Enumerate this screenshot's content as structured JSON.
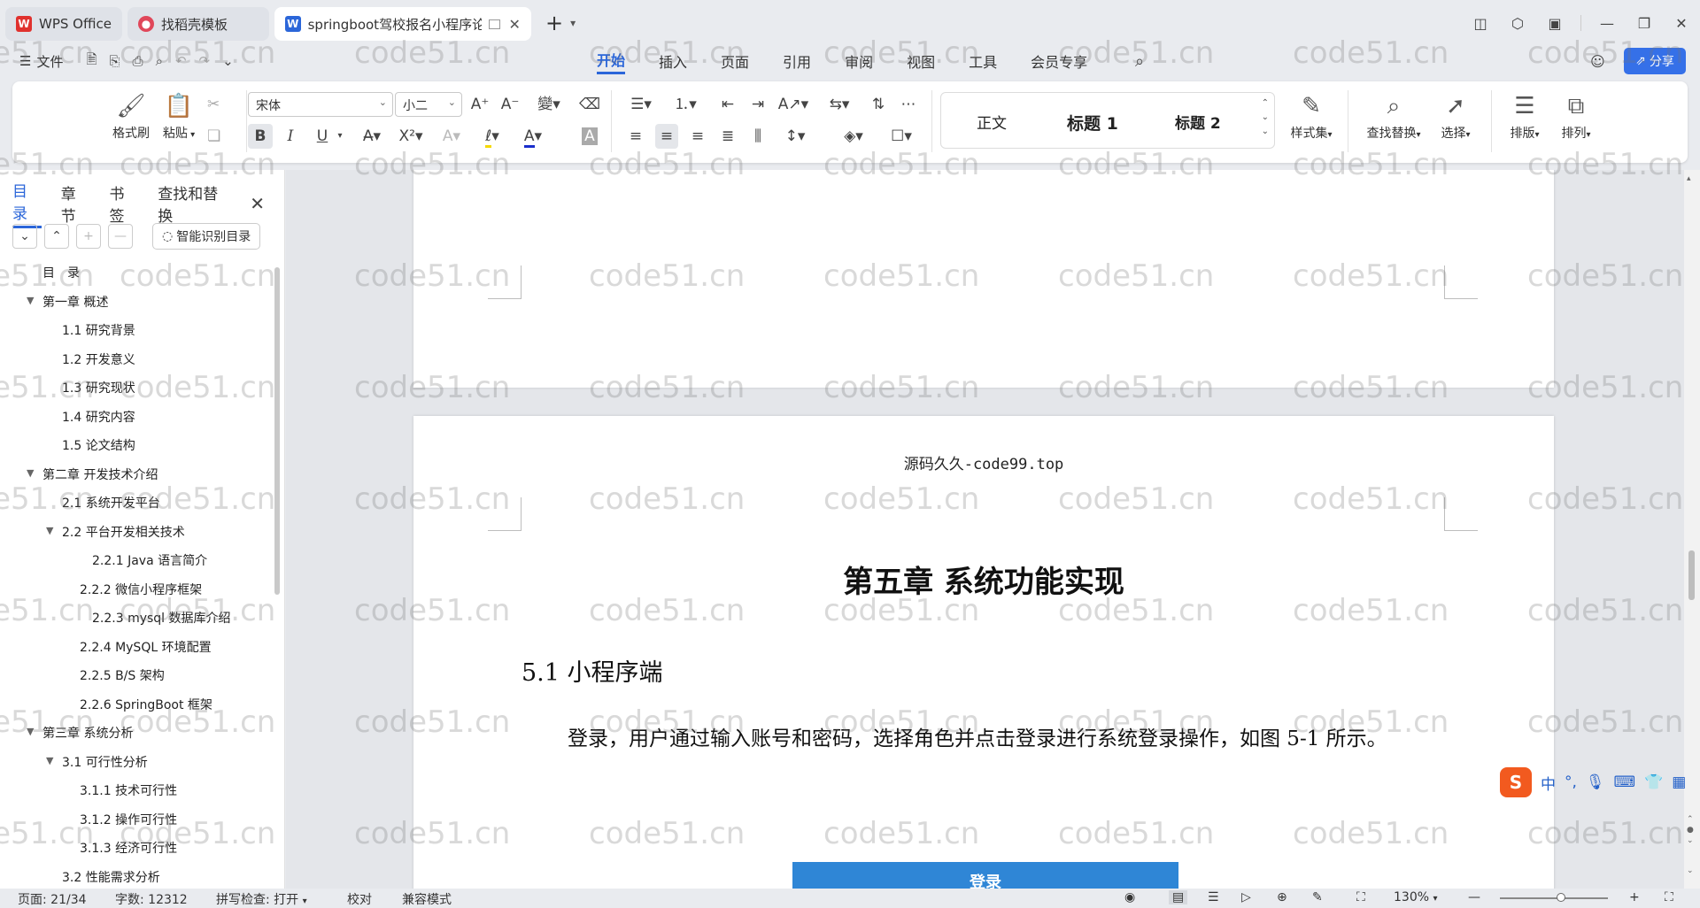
{
  "colors": {
    "accent": "#2b66d9",
    "share": "#3570e8",
    "wps_red": "#e0312e",
    "figure_blue": "#2f86d6"
  },
  "tabs": [
    {
      "label": "WPS Office",
      "icon": "wps-logo-icon"
    },
    {
      "label": "找稻壳模板",
      "icon": "daoke-logo-icon"
    },
    {
      "label": "springboot驾校报名小程序论",
      "icon": "word-doc-icon"
    }
  ],
  "menu": {
    "file": "文件",
    "ribbon_tabs": [
      "开始",
      "插入",
      "页面",
      "引用",
      "审阅",
      "视图",
      "工具",
      "会员专享"
    ],
    "share": "分享"
  },
  "ribbon": {
    "format_painter": "格式刷",
    "paste": "粘贴",
    "font_name": "宋体",
    "font_size": "小二",
    "bold": "B",
    "italic": "I",
    "underline": "U",
    "style_normal": "正文",
    "style_h1": "标题 1",
    "style_h2": "标题 2",
    "style_set": "样式集",
    "find_replace": "查找替换",
    "select": "选择",
    "layout": "排版",
    "arrange": "排列"
  },
  "panel": {
    "tabs": [
      "目录",
      "章节",
      "书签",
      "查找和替换"
    ],
    "smart_toc": "智能识别目录",
    "toc": [
      {
        "text": "目　录",
        "level": 0,
        "arrow": false
      },
      {
        "text": "第一章  概述",
        "level": 0,
        "arrow": true
      },
      {
        "text": "1.1  研究背景",
        "level": 1,
        "arrow": false
      },
      {
        "text": "1.2  开发意义",
        "level": 1,
        "arrow": false
      },
      {
        "text": "1.3  研究现状",
        "level": 1,
        "arrow": false
      },
      {
        "text": "1.4  研究内容",
        "level": 1,
        "arrow": false
      },
      {
        "text": "1.5  论文结构",
        "level": 1,
        "arrow": false
      },
      {
        "text": "第二章  开发技术介绍",
        "level": 0,
        "arrow": true
      },
      {
        "text": "2.1  系统开发平台",
        "level": 1,
        "arrow": false
      },
      {
        "text": "2.2  平台开发相关技术",
        "level": 1,
        "arrow": true
      },
      {
        "text": "2.2.1    Java 语言简介",
        "level": 3,
        "arrow": false
      },
      {
        "text": "2.2.2    微信小程序框架",
        "level": 2,
        "arrow": false
      },
      {
        "text": "2.2.3    mysql 数据库介绍",
        "level": 3,
        "arrow": false
      },
      {
        "text": "2.2.4    MySQL 环境配置",
        "level": 2,
        "arrow": false
      },
      {
        "text": "2.2.5    B/S 架构",
        "level": 2,
        "arrow": false
      },
      {
        "text": "2.2.6    SpringBoot 框架",
        "level": 2,
        "arrow": false
      },
      {
        "text": "第三章  系统分析",
        "level": 0,
        "arrow": true
      },
      {
        "text": "3.1  可行性分析",
        "level": 1,
        "arrow": true
      },
      {
        "text": "3.1.1  技术可行性",
        "level": 2,
        "arrow": false
      },
      {
        "text": "3.1.2  操作可行性",
        "level": 2,
        "arrow": false
      },
      {
        "text": "3.1.3  经济可行性",
        "level": 2,
        "arrow": false
      },
      {
        "text": "3.2  性能需求分析",
        "level": 1,
        "arrow": false
      }
    ]
  },
  "document": {
    "header": "源码久久-code99.top",
    "chapter_title": "第五章  系统功能实现",
    "section_title": "5.1 小程序端",
    "paragraph": "登录，用户通过输入账号和密码，选择角色并点击登录进行系统登录操作，如图 5-1 所示。",
    "figure_title": "登录"
  },
  "ime": {
    "lang": "中"
  },
  "status": {
    "page": "页面: 21/34",
    "words": "字数: 12312",
    "spell": "拼写检查: 打开",
    "proof": "校对",
    "compat": "兼容模式",
    "zoom": "130%"
  },
  "watermark": "code51.cn"
}
